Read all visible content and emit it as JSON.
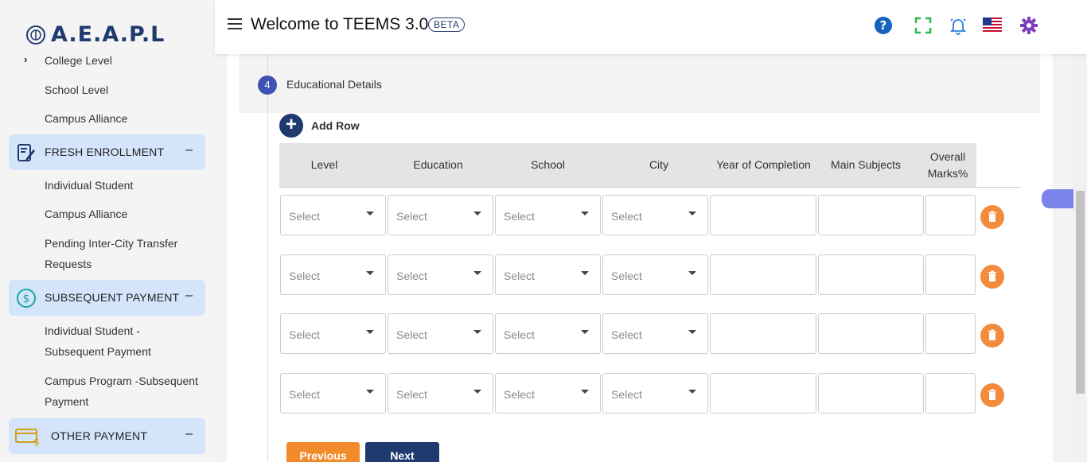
{
  "brand": {
    "logo_text": "A.E.A.P.L"
  },
  "sidebar": {
    "college_level": "College Level",
    "school_level": "School Level",
    "campus_alliance_top": "Campus Alliance",
    "fresh_enrollment": {
      "label": "FRESH ENROLLMENT",
      "items": [
        "Individual Student",
        "Campus Alliance",
        "Pending Inter-City Transfer",
        "Requests"
      ]
    },
    "subsequent_payment": {
      "label": "SUBSEQUENT PAYMENT",
      "items": [
        "Individual Student -",
        "Subsequent Payment",
        "Campus Program -Subsequent",
        "Payment"
      ]
    },
    "other_payment": {
      "label": "OTHER PAYMENT"
    },
    "collapse_symbol": "–"
  },
  "header": {
    "title": "Welcome to TEEMS 3.0",
    "badge": "BETA"
  },
  "step": {
    "number": "4",
    "label": "Educational Details"
  },
  "table": {
    "add_row_label": "Add Row",
    "add_symbol": "+",
    "columns": [
      "Level",
      "Education",
      "School",
      "City",
      "Year of Completion",
      "Main Subjects",
      "Overall Marks%"
    ],
    "select_placeholder": "Select",
    "row_count": 4
  },
  "buttons": {
    "previous": "Previous",
    "next": "Next"
  },
  "colors": {
    "accent": "#1f3a6e",
    "delete": "#f28b3c",
    "nav_group_bg": "#d4e4fb"
  }
}
